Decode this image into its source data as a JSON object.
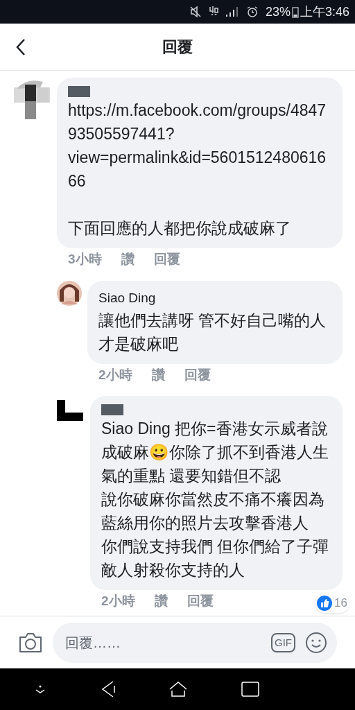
{
  "status_bar": {
    "battery": "23%",
    "time": "上午3:46"
  },
  "header": {
    "title": "回覆"
  },
  "comments": [
    {
      "avatar": {
        "kind": "picture"
      },
      "indent": false,
      "paragraphs": [
        "https://m.facebook.com/groups/484793505597441?view=permalink&id=560151248061666",
        "下面回應的人都把你說成破麻了"
      ],
      "time": "3小時",
      "like": "讚",
      "reply": "回覆"
    },
    {
      "avatar": {
        "kind": "person"
      },
      "indent": true,
      "name": "Siao Ding",
      "paragraphs": [
        "讓他們去講呀  管不好自己嘴的人才是破麻吧"
      ],
      "time": "2小時",
      "like": "讚",
      "reply": "回覆"
    },
    {
      "avatar": {
        "kind": "redacted"
      },
      "indent": true,
      "paragraphs": [
        "Siao Ding 把你=香港女示威者說成破麻😀你除了抓不到香港人生氣的重點 還要知錯但不認",
        "說你破麻你當然皮不痛不癢因為藍絲用你的照片去攻擊香港人",
        "你們說支持我們 但你們給了子彈敵人射殺你支持的人"
      ],
      "time": "2小時",
      "like": "讚",
      "reply": "回覆",
      "reactions": "16"
    }
  ],
  "composer": {
    "placeholder": "回覆……",
    "gif": "GIF"
  }
}
